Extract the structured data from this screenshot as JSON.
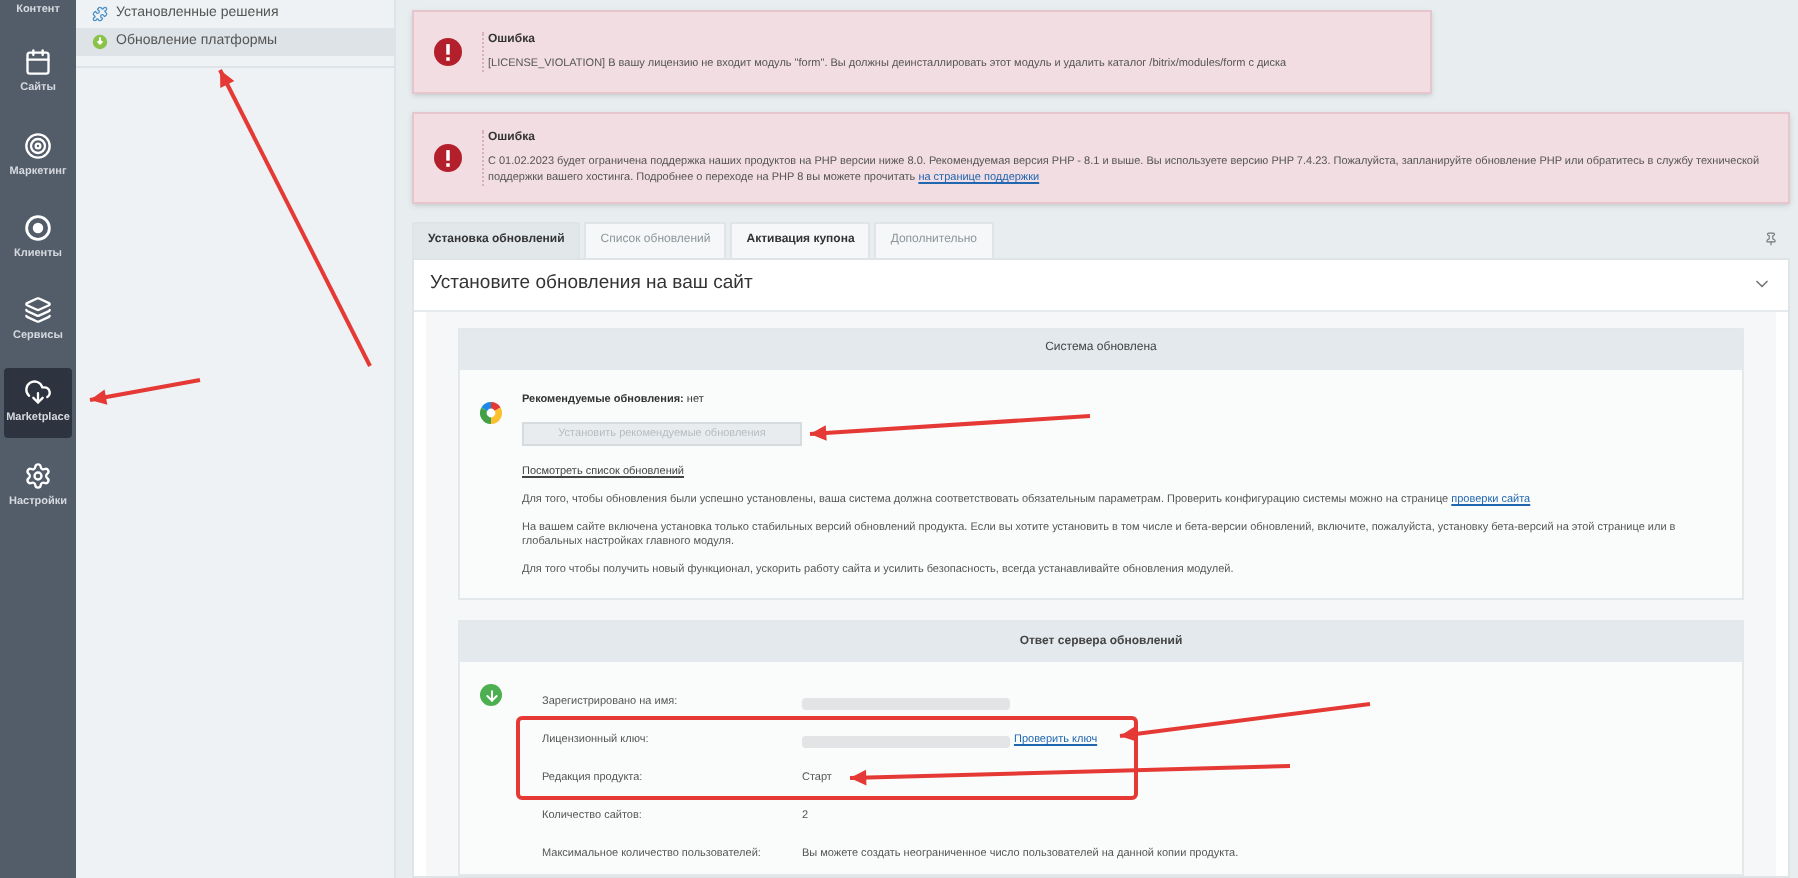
{
  "sidebar": {
    "items": [
      {
        "label": "Контент",
        "selected": false
      },
      {
        "label": "Сайты",
        "selected": false
      },
      {
        "label": "Маркетинг",
        "selected": false
      },
      {
        "label": "Клиенты",
        "selected": false
      },
      {
        "label": "Сервисы",
        "selected": false
      },
      {
        "label": "Marketplace",
        "selected": true
      },
      {
        "label": "Настройки",
        "selected": false
      }
    ]
  },
  "tree": {
    "items": [
      {
        "label": "Установленные решения",
        "selected": false
      },
      {
        "label": "Обновление платформы",
        "selected": true
      }
    ]
  },
  "alerts": [
    {
      "title": "Ошибка",
      "text": "[LICENSE_VIOLATION] В вашу лицензию не входит модуль \"form\". Вы должны деинсталлировать этот модуль и удалить каталог /bitrix/modules/form с диска"
    },
    {
      "title": "Ошибка",
      "text": "С 01.02.2023 будет ограничена поддержка наших продуктов на PHP версии ниже 8.0. Рекомендуемая версия PHP - 8.1 и выше. Вы используете версию PHP 7.4.23. Пожалуйста, запланируйте обновление PHP или обратитесь в службу технической поддержки вашего хостинга. Подробнее о переходе на PHP 8 вы можете прочитать",
      "link": "на странице поддержки"
    }
  ],
  "tabs": [
    {
      "label": "Установка обновлений",
      "selected": true,
      "disabled": false
    },
    {
      "label": "Список обновлений",
      "selected": false,
      "disabled": true
    },
    {
      "label": "Активация купона",
      "selected": false,
      "disabled": false
    },
    {
      "label": "Дополнительно",
      "selected": false,
      "disabled": true
    }
  ],
  "panel_title": "Установите обновления на ваш сайт",
  "system_section": {
    "header": "Система обновлена",
    "recommended_label": "Рекомендуемые обновления:",
    "recommended_value": "нет",
    "install_button": {
      "label": "Установить рекомендуемые обновления",
      "disabled": true
    },
    "list_link": "Посмотреть список обновлений",
    "paragraphs": [
      {
        "text": "Для того, чтобы обновления были успешно установлены, ваша система должна соответствовать обязательным параметрам. Проверить конфигурацию системы можно на странице",
        "link": "проверки сайта"
      },
      {
        "text": "На вашем сайте включена установка только стабильных версий обновлений продукта. Если вы хотите установить в том числе и бета-версии обновлений, включите, пожалуйста, установку бета-версий на этой странице или в глобальных настройках главного модуля."
      },
      {
        "text": "Для того чтобы получить новый функционал, ускорить работу сайта и усилить безопасность, всегда устанавливайте обновления модулей."
      }
    ]
  },
  "server_section": {
    "header": "Ответ сервера обновлений",
    "rows": [
      {
        "label": "Зарегистрировано на имя:",
        "kind": "redacted",
        "value": null,
        "link": null
      },
      {
        "label": "Лицензионный ключ:",
        "kind": "redacted",
        "value": null,
        "link": "Проверить ключ"
      },
      {
        "label": "Редакция продукта:",
        "kind": "text",
        "value": "Старт",
        "link": null
      },
      {
        "label": "Количество сайтов:",
        "kind": "text",
        "value": "2",
        "link": null
      },
      {
        "label": "Максимальное количество пользователей:",
        "kind": "text",
        "value": "Вы можете создать неограниченное число пользователей на данной копии продукта.",
        "link": null
      }
    ]
  }
}
